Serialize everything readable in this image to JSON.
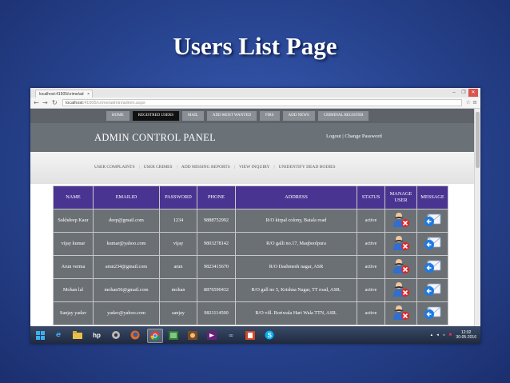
{
  "slide": {
    "title": "Users List Page"
  },
  "browser": {
    "tab_title": "localhost:41505/crime/ad",
    "url_host": "localhost:",
    "url_rest": "41505/crime/admin/admin.aspx"
  },
  "topnav": {
    "items": [
      "HOME",
      "REGISTRED USERS",
      "MAIL",
      "ADD MOST WANTED",
      "FIRS",
      "ADD NEWS",
      "CRIMINAL REGISTER"
    ]
  },
  "header": {
    "title": "ADMIN CONTROL PANEL",
    "logout": "Logout",
    "separator": "|",
    "change_password": "Change Password"
  },
  "subnav": {
    "items": [
      "USER COMPLAINTS",
      "USER CRIMES",
      "ADD MISSING REPORTS",
      "VIEW INQUIRY",
      "UNIDENTIFY DEAD BODIES"
    ],
    "separator": "|"
  },
  "table": {
    "headers": [
      "NAME",
      "EMAILID",
      "PASSWORD",
      "PHONE",
      "ADDRESS",
      "STATUS",
      "MANAGE USER",
      "MESSAGE"
    ],
    "rows": [
      {
        "name": "Sukhdeep Kaur",
        "email": "deep@gmail.com",
        "password": "1234",
        "phone": "9888752992",
        "address": "R/O kirpal colony, Batala road",
        "status": "active"
      },
      {
        "name": "vijay kumar",
        "email": "kumar@yahoo.com",
        "password": "vijay",
        "phone": "9803278142",
        "address": "R/O galli no.17, Maqboolpura",
        "status": "active"
      },
      {
        "name": "Arun verma",
        "email": "arun234@gmail.com",
        "password": "arun",
        "phone": "9823415670",
        "address": "R/O Dashmesh nagar, ASR",
        "status": "active"
      },
      {
        "name": "Mohan lal",
        "email": "mohan56@gmail.com",
        "password": "mohan",
        "phone": "8876590432",
        "address": "R/O gall no 5, Krishna Nagar, TT road, ASR.",
        "status": "active"
      },
      {
        "name": "Sanjay yadav",
        "email": "yadav@yahoo.com",
        "password": "sanjay",
        "phone": "9821114590",
        "address": "R/O vill. Roriwala Hari Wala TTN, ASR.",
        "status": "active"
      }
    ]
  },
  "taskbar": {
    "time": "12:02",
    "date": "30-05-2016"
  },
  "colors": {
    "table_header": "#4a3492",
    "table_body": "#6b7075",
    "nav_dark": "#5d6369",
    "slide_bg": "#2a4896"
  }
}
